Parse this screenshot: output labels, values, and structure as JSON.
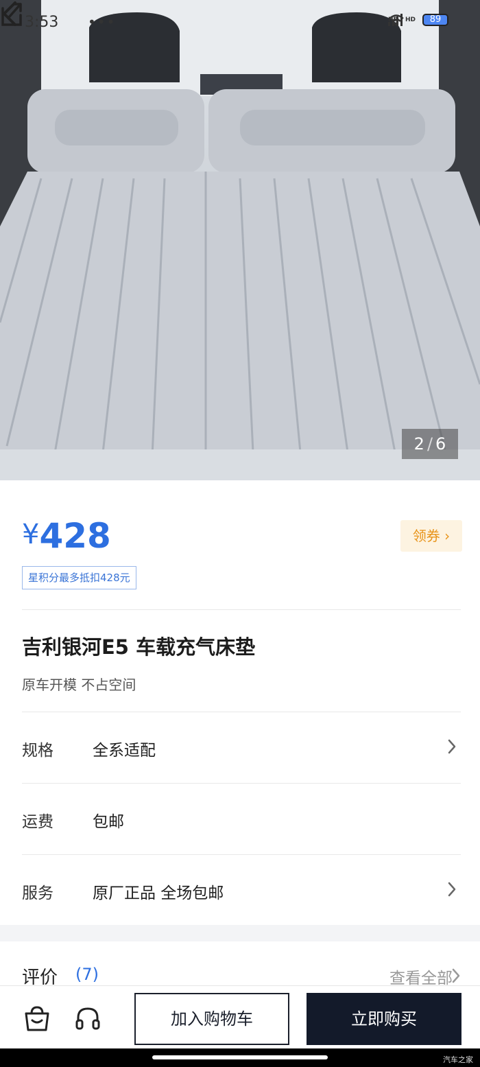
{
  "status_bar": {
    "time": "3:53",
    "dots": "•••",
    "hd1": "HD",
    "hd2": "HD",
    "battery": "89"
  },
  "gallery": {
    "current": "2",
    "separator": "/",
    "total": "6"
  },
  "price": {
    "currency": "¥",
    "amount": "428"
  },
  "coupon": {
    "label": "领券"
  },
  "points_tag": "星积分最多抵扣428元",
  "product": {
    "title": "吉利银河E5 车载充气床垫",
    "subtitle": "原车开模 不占空间"
  },
  "details": [
    {
      "label": "规格",
      "value": "全系适配"
    },
    {
      "label": "运费",
      "value": "包邮"
    },
    {
      "label": "服务",
      "value": "原厂正品 全场包邮"
    }
  ],
  "reviews": {
    "label": "评价",
    "count": "(7)",
    "view_all": "查看全部"
  },
  "actions": {
    "add_to_cart": "加入购物车",
    "buy_now": "立即购买"
  },
  "watermark": "汽车之家",
  "colors": {
    "accent": "#2d6fe0",
    "coupon": "#e8941a",
    "primary_button": "#131a2a"
  },
  "icons": [
    "back-icon",
    "share-icon",
    "shop-icon",
    "customer-service-icon",
    "chevron-right-icon"
  ]
}
